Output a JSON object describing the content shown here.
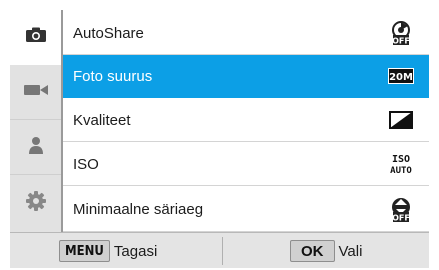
{
  "tabs": [
    {
      "icon": "camera-icon",
      "active": true
    },
    {
      "icon": "video-camera-icon",
      "active": false
    },
    {
      "icon": "person-icon",
      "active": false
    },
    {
      "icon": "gear-icon",
      "active": false
    }
  ],
  "menu": {
    "items": [
      {
        "label": "AutoShare",
        "value_icon": "autoshare-off-icon",
        "value_text": "OFF",
        "selected": false
      },
      {
        "label": "Foto suurus",
        "value_icon": "photo-size-20m-icon",
        "value_text": "20M",
        "selected": true
      },
      {
        "label": "Kvaliteet",
        "value_icon": "quality-icon",
        "selected": false
      },
      {
        "label": "ISO",
        "value_icon": "iso-auto-icon",
        "value_text": "AUTO",
        "value_text_top": "ISO",
        "selected": false
      },
      {
        "label": "Minimaalne säriaeg",
        "value_icon": "min-shutter-off-icon",
        "value_text": "OFF",
        "selected": false
      }
    ]
  },
  "bottom_bar": {
    "back_key": "MENU",
    "back_label": "Tagasi",
    "ok_key": "OK",
    "ok_label": "Vali"
  },
  "colors": {
    "highlight": "#0c9fe6",
    "tab_background": "#e2e2e2",
    "bottom_bar": "#e4e4e4"
  }
}
